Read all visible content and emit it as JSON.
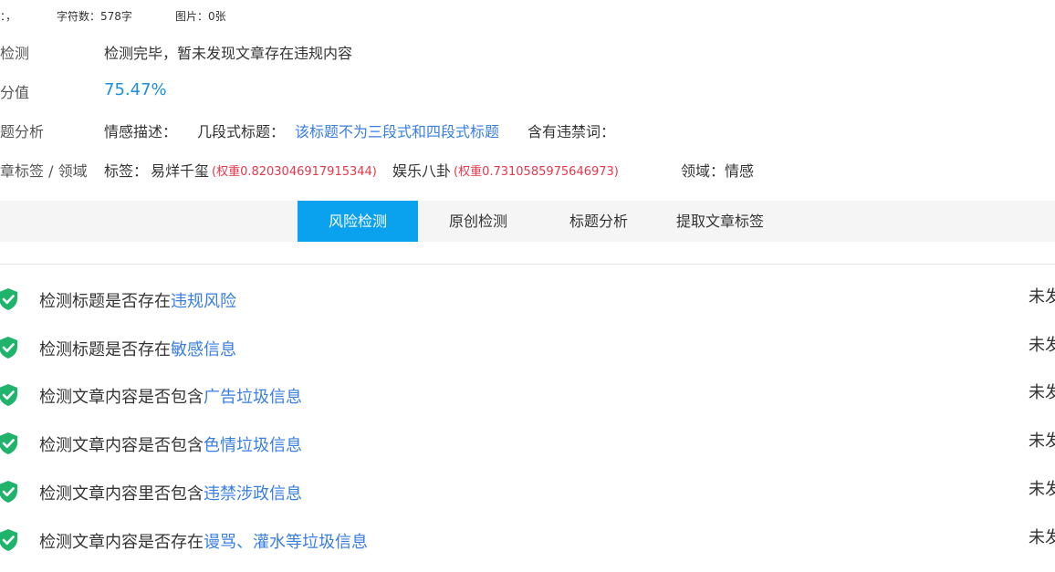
{
  "meta": {
    "prefix": "：，",
    "char_count": "字符数：578字",
    "images": "图片：0张"
  },
  "rows": {
    "risk": {
      "label": "检测",
      "value": "检测完毕，暂未发现文章存在违规内容"
    },
    "score": {
      "label": "分值",
      "value": "75.47%"
    },
    "title_analysis": {
      "label": "题分析",
      "emotion_label": "情感描述：",
      "multi_title_label": "几段式标题：",
      "multi_title_value": "该标题不为三段式和四段式标题",
      "banned_label": "含有违禁词："
    },
    "tags": {
      "label": "章标签 / 领域",
      "tag_prefix": "标签：",
      "tag1_name": "易烊千玺",
      "tag1_weight": "(权重0.8203046917915344)",
      "tag2_name": "娱乐八卦",
      "tag2_weight": "(权重0.7310585975646973)",
      "domain": "领域：情感"
    }
  },
  "tabs": [
    {
      "label": "风险检测",
      "active": true
    },
    {
      "label": "原创检测",
      "active": false
    },
    {
      "label": "标题分析",
      "active": false
    },
    {
      "label": "提取文章标签",
      "active": false
    }
  ],
  "checks": [
    {
      "text": "检测标题是否存在",
      "link": "违规风险",
      "status": "未发"
    },
    {
      "text": "检测标题是否存在",
      "link": "敏感信息",
      "status": "未发"
    },
    {
      "text": "检测文章内容是否包含",
      "link": "广告垃圾信息",
      "status": "未发"
    },
    {
      "text": "检测文章内容是否包含",
      "link": "色情垃圾信息",
      "status": "未发"
    },
    {
      "text": "检测文章内容里否包含",
      "link": "违禁涉政信息",
      "status": "未发"
    },
    {
      "text": "检测文章内容是否存在",
      "link": "谩骂、灌水等垃圾信息",
      "status": "未发"
    }
  ],
  "colors": {
    "accent": "#0aa1ee",
    "link": "#3a7ee0",
    "weight": "#e8364b",
    "shield": "#1fb36b"
  },
  "icons": {
    "check": "shield-check-icon"
  }
}
